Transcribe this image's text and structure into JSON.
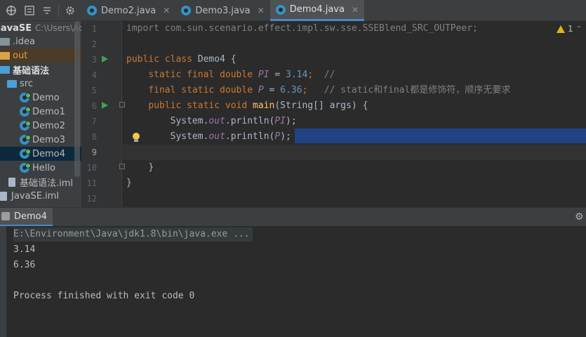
{
  "toolbar": {
    "icons": [
      "target-icon",
      "expand-all-icon",
      "collapse-all-icon",
      "gear-icon"
    ]
  },
  "tabs": [
    {
      "label": "Demo2.java",
      "active": false
    },
    {
      "label": "Demo3.java",
      "active": false
    },
    {
      "label": "Demo4.java",
      "active": true
    }
  ],
  "tree": {
    "root_label": "JavaSE",
    "root_path": "C:\\Users\\Adm",
    "items": [
      {
        "label": ".idea",
        "icon": "folder-icon"
      },
      {
        "label": "out",
        "icon": "folder-icon"
      },
      {
        "label": "基础语法",
        "icon": "module-folder-icon"
      },
      {
        "label": "src",
        "icon": "source-folder-icon"
      },
      {
        "label": "Demo",
        "icon": "class-icon"
      },
      {
        "label": "Demo1",
        "icon": "class-icon"
      },
      {
        "label": "Demo2",
        "icon": "class-icon"
      },
      {
        "label": "Demo3",
        "icon": "class-icon"
      },
      {
        "label": "Demo4",
        "icon": "class-icon"
      },
      {
        "label": "Hello",
        "icon": "class-icon"
      },
      {
        "label": "基础语法.iml",
        "icon": "iml-file-icon"
      },
      {
        "label": "JavaSE.iml",
        "icon": "iml-file-icon"
      }
    ]
  },
  "editor": {
    "warning_count": "1",
    "line_numbers": [
      "1",
      "2",
      "3",
      "4",
      "5",
      "6",
      "7",
      "8",
      "9",
      "10",
      "11",
      "12"
    ],
    "code": {
      "l1": "import com.sun.scenario.effect.impl.sw.sse.SSEBlend_SRC_OUTPeer;",
      "l3_kw": "public class",
      "l3_name": " Demo4 {",
      "l4_kw": "static final double",
      "l4_var": "PI",
      "l4_eq": " = ",
      "l4_num": "3.14",
      "l4_semi": ";",
      "l4_cmt": "//",
      "l5_kw": "final static double",
      "l5_var": "P",
      "l5_eq": " = ",
      "l5_num": "6.36",
      "l5_semi": ";",
      "l5_cmt": "// static和final都是修饰符，顺序无要求",
      "l6_kw": "public static void",
      "l6_fn": "main",
      "l6_rest": "(String[] args) {",
      "l7_a": "System.",
      "l7_out": "out",
      "l7_b": ".println(",
      "l7_var": "PI",
      "l7_c": ");",
      "l8_a": "System.",
      "l8_out": "out",
      "l8_b": ".println(",
      "l8_var": "P",
      "l8_c": ");",
      "l10": "}",
      "l11": "}"
    }
  },
  "run": {
    "tab_label": "Demo4",
    "command": "E:\\Environment\\Java\\jdk1.8\\bin\\java.exe ...",
    "output": [
      "3.14",
      "6.36"
    ],
    "finish": "Process finished with exit code 0"
  },
  "colors": {
    "keyword": "#cc7832",
    "number": "#6897bb",
    "comment": "#808080",
    "function": "#ffc66d",
    "static_field": "#9876aa",
    "selection": "#214283"
  }
}
